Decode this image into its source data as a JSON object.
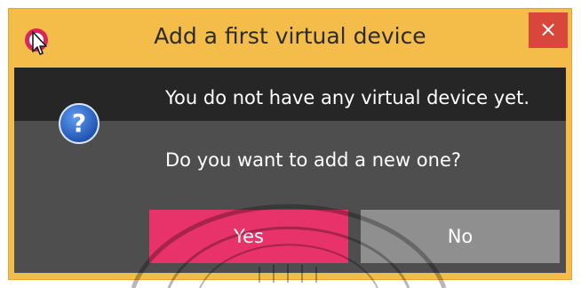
{
  "dialog": {
    "title": "Add a first virtual device",
    "close_glyph": "×",
    "app_icon": "pointer-cursor-icon",
    "question_icon": "question-mark-icon",
    "message_line1": "You do not have any virtual device yet.",
    "message_line2": "Do you want to add a new one?",
    "yes_label": "Yes",
    "no_label": "No"
  },
  "colors": {
    "title_bar": "#f4bd4a",
    "close_button": "#d8473a",
    "message_band": "#262626",
    "body": "#4e4e4e",
    "yes_button": "#e7326a",
    "no_button": "#8f8f8f",
    "question_icon": "#2a67c9"
  }
}
